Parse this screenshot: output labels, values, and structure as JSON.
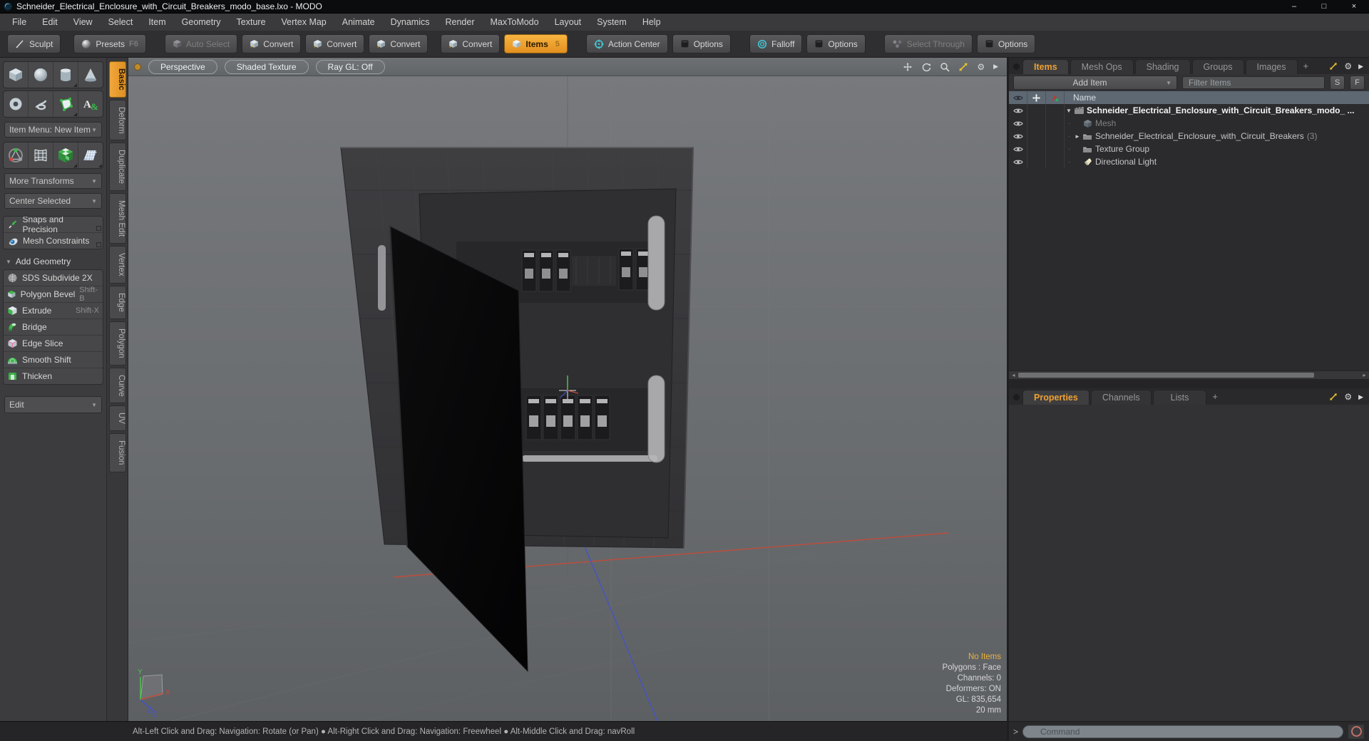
{
  "window": {
    "title": "Schneider_Electrical_Enclosure_with_Circuit_Breakers_modo_base.lxo - MODO",
    "controls": {
      "minimize": "–",
      "maximize": "□",
      "close": "×"
    }
  },
  "menu": [
    "File",
    "Edit",
    "View",
    "Select",
    "Item",
    "Geometry",
    "Texture",
    "Vertex Map",
    "Animate",
    "Dynamics",
    "Render",
    "MaxToModo",
    "Layout",
    "System",
    "Help"
  ],
  "toolbar": {
    "sculpt": "Sculpt",
    "presets": "Presets",
    "presets_shortcut": "F6",
    "auto_select": "Auto Select",
    "convert_1": "Convert",
    "convert_2": "Convert",
    "convert_3": "Convert",
    "convert_4": "Convert",
    "items": "Items",
    "items_badge": "5",
    "action_center": "Action Center",
    "options_1": "Options",
    "falloff": "Falloff",
    "options_2": "Options",
    "select_through": "Select Through",
    "options_3": "Options"
  },
  "left_panel": {
    "item_menu": "Item Menu: New Item",
    "more_transforms": "More Transforms",
    "center_selected": "Center Selected",
    "snaps_and_precision": "Snaps and Precision",
    "mesh_constraints": "Mesh Constraints",
    "add_geometry": "Add Geometry",
    "tools": [
      {
        "label": "SDS Subdivide 2X",
        "shortcut": ""
      },
      {
        "label": "Polygon Bevel",
        "shortcut": "Shift-B"
      },
      {
        "label": "Extrude",
        "shortcut": "Shift-X"
      },
      {
        "label": "Bridge",
        "shortcut": ""
      },
      {
        "label": "Edge Slice",
        "shortcut": ""
      },
      {
        "label": "Smooth Shift",
        "shortcut": ""
      },
      {
        "label": "Thicken",
        "shortcut": ""
      }
    ],
    "edit": "Edit"
  },
  "side_tabs": [
    "Basic",
    "Deform",
    "Duplicate",
    "Mesh Edit",
    "Vertex",
    "Edge",
    "Polygon",
    "Curve",
    "UV",
    "Fusion"
  ],
  "viewport": {
    "camera": "Perspective",
    "shading": "Shaded Texture",
    "ray_gl": "Ray GL: Off",
    "axes": {
      "x": "X",
      "y": "Y",
      "z": "Z"
    },
    "status": {
      "selection": "No Items",
      "lines": [
        "Polygons : Face",
        "Channels: 0",
        "Deformers: ON",
        "GL: 835,654",
        "20 mm"
      ]
    }
  },
  "right_panel": {
    "tabs": [
      "Items",
      "Mesh Ops",
      "Shading",
      "Groups",
      "Images"
    ],
    "tab_add": "+",
    "add_item": "Add Item",
    "filter_placeholder": "Filter Items",
    "button_s": "S",
    "button_f": "F",
    "name_header": "Name",
    "tree": [
      {
        "label": "Schneider_Electrical_Enclosure_with_Circuit_Breakers_modo_ ...",
        "suffix": ""
      },
      {
        "label": "Mesh",
        "suffix": ""
      },
      {
        "label": "Schneider_Electrical_Enclosure_with_Circuit_Breakers",
        "suffix": "(3)"
      },
      {
        "label": "Texture Group",
        "suffix": ""
      },
      {
        "label": "Directional Light",
        "suffix": ""
      }
    ],
    "properties_tabs": [
      "Properties",
      "Channels",
      "Lists"
    ],
    "properties_tab_add": "+"
  },
  "command_bar": {
    "prompt": ">",
    "placeholder": "Command"
  },
  "status_bar": {
    "text": "Alt-Left Click and Drag: Navigation: Rotate (or Pan)  ●  Alt-Right Click and Drag: Navigation: Freewheel  ●  Alt-Middle Click and Drag: navRoll"
  },
  "icons": {
    "dropdown_arrow": "▼",
    "section_collapse": "▼",
    "expand_open": "▼",
    "expand_closed": "►",
    "gear": "⚙",
    "flyout": "▶",
    "scroll_left": "◂",
    "scroll_right": "▸",
    "connector_dots": "··",
    "text_tool": "A&"
  },
  "colors": {
    "accent_orange": "#f0a132",
    "axis_x_red": "#c24b3a",
    "axis_y_green": "#4cc44c",
    "axis_z_blue": "#4554c2",
    "selection_status_text": "#e8b23c",
    "command_ring": "#c4706a"
  }
}
